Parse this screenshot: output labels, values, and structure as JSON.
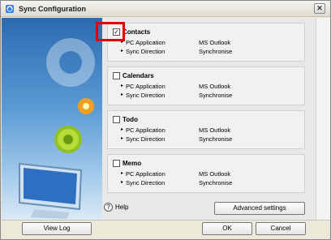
{
  "window": {
    "title": "Sync Configuration",
    "close_glyph": "✕"
  },
  "sections": [
    {
      "title": "Contacts",
      "checked": true,
      "check_glyph": "✓",
      "rows": [
        {
          "label": "PC Application",
          "value": "MS Outlook"
        },
        {
          "label": "Sync Direction",
          "value": "Synchronise"
        }
      ]
    },
    {
      "title": "Calendars",
      "checked": false,
      "check_glyph": "",
      "rows": [
        {
          "label": "PC Application",
          "value": "MS Outlook"
        },
        {
          "label": "Sync Direction",
          "value": "Synchronise"
        }
      ]
    },
    {
      "title": "Todo",
      "checked": false,
      "check_glyph": "",
      "rows": [
        {
          "label": "PC Application",
          "value": "MS Outlook"
        },
        {
          "label": "Sync Direction",
          "value": "Synchronise"
        }
      ]
    },
    {
      "title": "Memo",
      "checked": false,
      "check_glyph": "",
      "rows": [
        {
          "label": "PC Application",
          "value": "MS Outlook"
        },
        {
          "label": "Sync Direction",
          "value": "Synchronise"
        }
      ]
    }
  ],
  "help": {
    "icon_glyph": "?",
    "label": "Help"
  },
  "buttons": {
    "advanced": "Advanced settings",
    "view_log": "View Log",
    "ok": "OK",
    "cancel": "Cancel"
  },
  "icons": {
    "app": "sync-app-icon",
    "close": "close-icon",
    "help": "help-icon",
    "row_arrow": "triangle-right-icon"
  },
  "colors": {
    "highlight": "#e00000",
    "left_panel_top": "#2b6ab0",
    "left_panel_bottom": "#dcebf6"
  }
}
